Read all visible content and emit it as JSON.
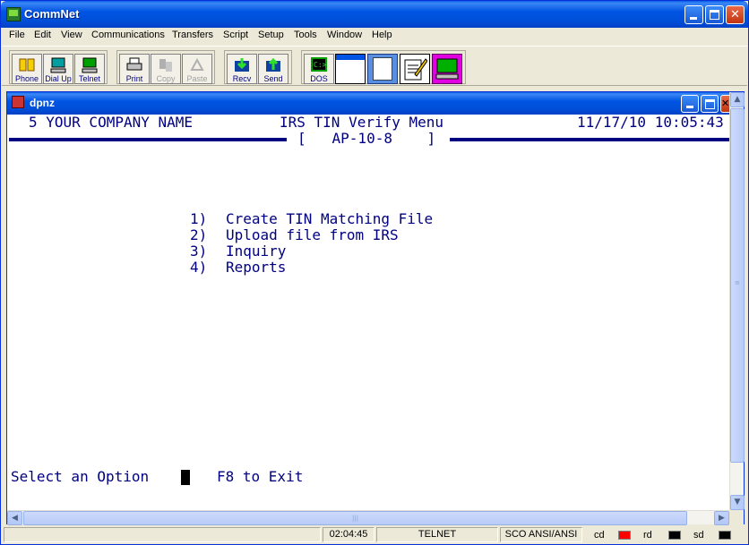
{
  "window": {
    "title": "CommNet"
  },
  "menu": [
    "File",
    "Edit",
    "View",
    "Communications",
    "Transfers",
    "Script",
    "Setup",
    "Tools",
    "Window",
    "Help"
  ],
  "toolbar": {
    "buttons": [
      "Phone",
      "Dial Up",
      "Telnet",
      "Print",
      "Copy",
      "Paste",
      "Recv",
      "Send",
      "DOS"
    ]
  },
  "session": {
    "title": "dpnz"
  },
  "terminal": {
    "company": "5 YOUR COMPANY NAME",
    "menu_title": "IRS TIN Verify Menu",
    "program_id": "[   AP-10-8    ]",
    "datetime": "11/17/10 10:05:43",
    "options": [
      {
        "num": "1)",
        "label": "Create TIN Matching File"
      },
      {
        "num": "2)",
        "label": "Upload file from IRS"
      },
      {
        "num": "3)",
        "label": "Inquiry"
      },
      {
        "num": "4)",
        "label": "Reports"
      }
    ],
    "prompt": "Select an Option",
    "exit_hint": "F8 to Exit"
  },
  "status": {
    "time": "02:04:45",
    "protocol": "TELNET",
    "emulation": "SCO ANSI/ANSI",
    "indicators": [
      {
        "label": "cd",
        "color": "#ff0000"
      },
      {
        "label": "rd",
        "color": "#000000"
      },
      {
        "label": "sd",
        "color": "#000000"
      }
    ]
  },
  "colors": {
    "terminal_text": "#000080",
    "titlebar": "#0054e3"
  }
}
